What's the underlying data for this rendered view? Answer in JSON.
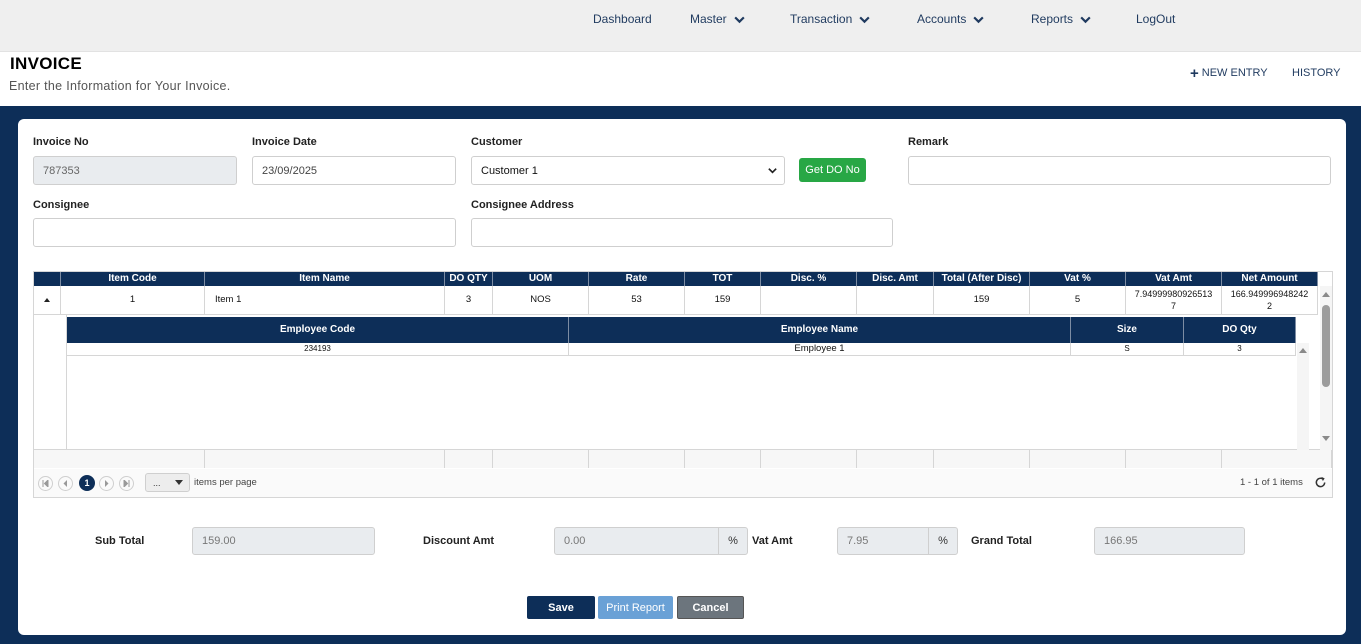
{
  "nav": {
    "dashboard": "Dashboard",
    "master": "Master",
    "transaction": "Transaction",
    "accounts": "Accounts",
    "reports": "Reports",
    "logout": "LogOut"
  },
  "header": {
    "title": "INVOICE",
    "subtitle": "Enter the Information for Your Invoice.",
    "new_entry": "NEW ENTRY",
    "history": "HISTORY"
  },
  "form": {
    "invoice_no_label": "Invoice No",
    "invoice_no_value": "787353",
    "invoice_date_label": "Invoice Date",
    "invoice_date_value": "23/09/2025",
    "customer_label": "Customer",
    "customer_value": "Customer 1",
    "get_do_button": "Get DO No",
    "remark_label": "Remark",
    "remark_value": "",
    "consignee_label": "Consignee",
    "consignee_value": "",
    "consignee_address_label": "Consignee Address",
    "consignee_address_value": ""
  },
  "grid": {
    "headers": [
      "Item Code",
      "Item Name",
      "DO QTY",
      "UOM",
      "Rate",
      "TOT",
      "Disc. %",
      "Disc. Amt",
      "Total (After Disc)",
      "Vat %",
      "Vat Amt",
      "Net Amount"
    ],
    "row": {
      "item_code": "1",
      "item_name": "Item 1",
      "do_qty": "3",
      "uom": "NOS",
      "rate": "53",
      "tot": "159",
      "disc_pct": "",
      "disc_amt": "",
      "total_after_disc": "159",
      "vat_pct": "5",
      "vat_amt_line1": "7.94999980926513",
      "vat_amt_line2": "7",
      "net_amount_line1": "166.949996948242",
      "net_amount_line2": "2"
    },
    "sub_headers": [
      "Employee Code",
      "Employee Name",
      "Size",
      "DO Qty"
    ],
    "sub_row": {
      "employee_code": "234193",
      "employee_name": "Employee 1",
      "size": "S",
      "do_qty": "3"
    },
    "pager": {
      "current_page": "1",
      "page_size": "...",
      "items_per_page": "items per page",
      "summary": "1 - 1 of 1 items"
    }
  },
  "totals": {
    "sub_total_label": "Sub Total",
    "sub_total_value": "159.00",
    "discount_label": "Discount Amt",
    "discount_value": "0.00",
    "discount_unit": "%",
    "vat_label": "Vat Amt",
    "vat_value": "7.95",
    "vat_unit": "%",
    "grand_total_label": "Grand Total",
    "grand_total_value": "166.95"
  },
  "actions": {
    "save": "Save",
    "print_report": "Print Report",
    "cancel": "Cancel"
  },
  "colors": {
    "navy": "#0d2e58",
    "green": "#28a745",
    "print_blue": "#6aa1d6",
    "cancel_grey": "#6c757d"
  }
}
